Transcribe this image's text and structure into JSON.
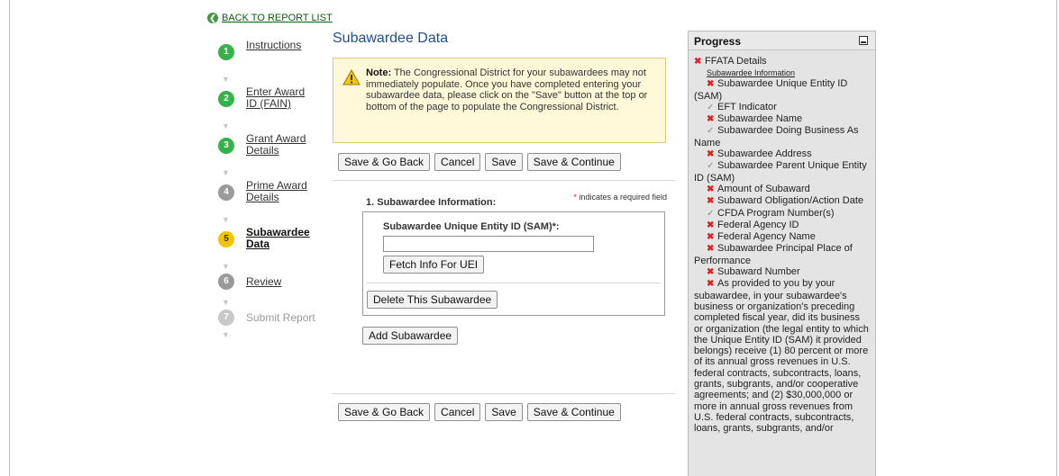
{
  "back_link": "BACK TO REPORT LIST",
  "steps": [
    {
      "num": "1",
      "label": "Instructions",
      "state": "done"
    },
    {
      "num": "2",
      "label": "Enter Award ID (FAIN)",
      "state": "done"
    },
    {
      "num": "3",
      "label": "Grant Award Details",
      "state": "done"
    },
    {
      "num": "4",
      "label": "Prime Award Details",
      "state": "pending"
    },
    {
      "num": "5",
      "label": "Subawardee Data",
      "state": "current"
    },
    {
      "num": "6",
      "label": "Review",
      "state": "pending"
    },
    {
      "num": "7",
      "label": "Submit Report",
      "state": "disabled"
    }
  ],
  "main": {
    "title": "Subawardee Data",
    "note_label": "Note:",
    "note_text": " The Congressional District for your subawardees may not immediately populate. Once you have completed entering your subawardee data, please click on the \"Save\" button at the top or bottom of the page to populate the Congressional District.",
    "buttons": {
      "save_go_back": "Save & Go Back",
      "cancel": "Cancel",
      "save": "Save",
      "save_continue": "Save & Continue"
    },
    "section_title": "1. Subawardee Information:",
    "required_note": "indicates a required field",
    "required_star": "*",
    "uei_label": "Subawardee Unique Entity ID (SAM)*:",
    "uei_value": "",
    "fetch_button": "Fetch Info For UEI",
    "delete_button": "Delete This Subawardee",
    "add_button": "Add Subawardee"
  },
  "progress": {
    "title": "Progress",
    "section": "FFATA Details",
    "subsection": "Subawardee Information",
    "items": [
      {
        "status": "x",
        "text": "Subawardee Unique Entity ID (SAM)"
      },
      {
        "status": "ok",
        "text": "EFT Indicator"
      },
      {
        "status": "x",
        "text": "Subawardee Name"
      },
      {
        "status": "ok",
        "text": "Subawardee Doing Business As Name"
      },
      {
        "status": "x",
        "text": "Subawardee Address"
      },
      {
        "status": "ok",
        "text": "Subawardee Parent Unique Entity ID (SAM)"
      },
      {
        "status": "x",
        "text": "Amount of Subaward"
      },
      {
        "status": "x",
        "text": "Subaward Obligation/Action Date"
      },
      {
        "status": "ok",
        "text": "CFDA Program Number(s)"
      },
      {
        "status": "x",
        "text": "Federal Agency ID"
      },
      {
        "status": "x",
        "text": "Federal Agency Name"
      },
      {
        "status": "x",
        "text": "Subawardee Principal Place of Performance"
      },
      {
        "status": "x",
        "text": "Subaward Number"
      },
      {
        "status": "x",
        "text": "As provided to you by your subawardee, in your subawardee's business or organization's preceding completed fiscal year, did its business or organization (the legal entity to which the Unique Entity ID (SAM) it provided belongs) receive (1) 80 percent or more of its annual gross revenues in U.S. federal contracts, subcontracts, loans, grants, subgrants, and/or cooperative agreements; and (2) $30,000,000 or more in annual gross revenues from U.S. federal contracts, subcontracts, loans, grants, subgrants, and/or"
      }
    ]
  },
  "icons": {
    "back": "back-arrow-circle-icon",
    "warning": "warning-icon",
    "minimize": "minimize-icon",
    "x_mark": "x-mark-icon",
    "check": "check-icon",
    "chevron": "chevron-down-icon"
  },
  "colors": {
    "done": "#36b24a",
    "current": "#f2c300",
    "pending": "#9a9a9a",
    "title": "#1f4e8c",
    "note_bg": "#fff9d9"
  }
}
